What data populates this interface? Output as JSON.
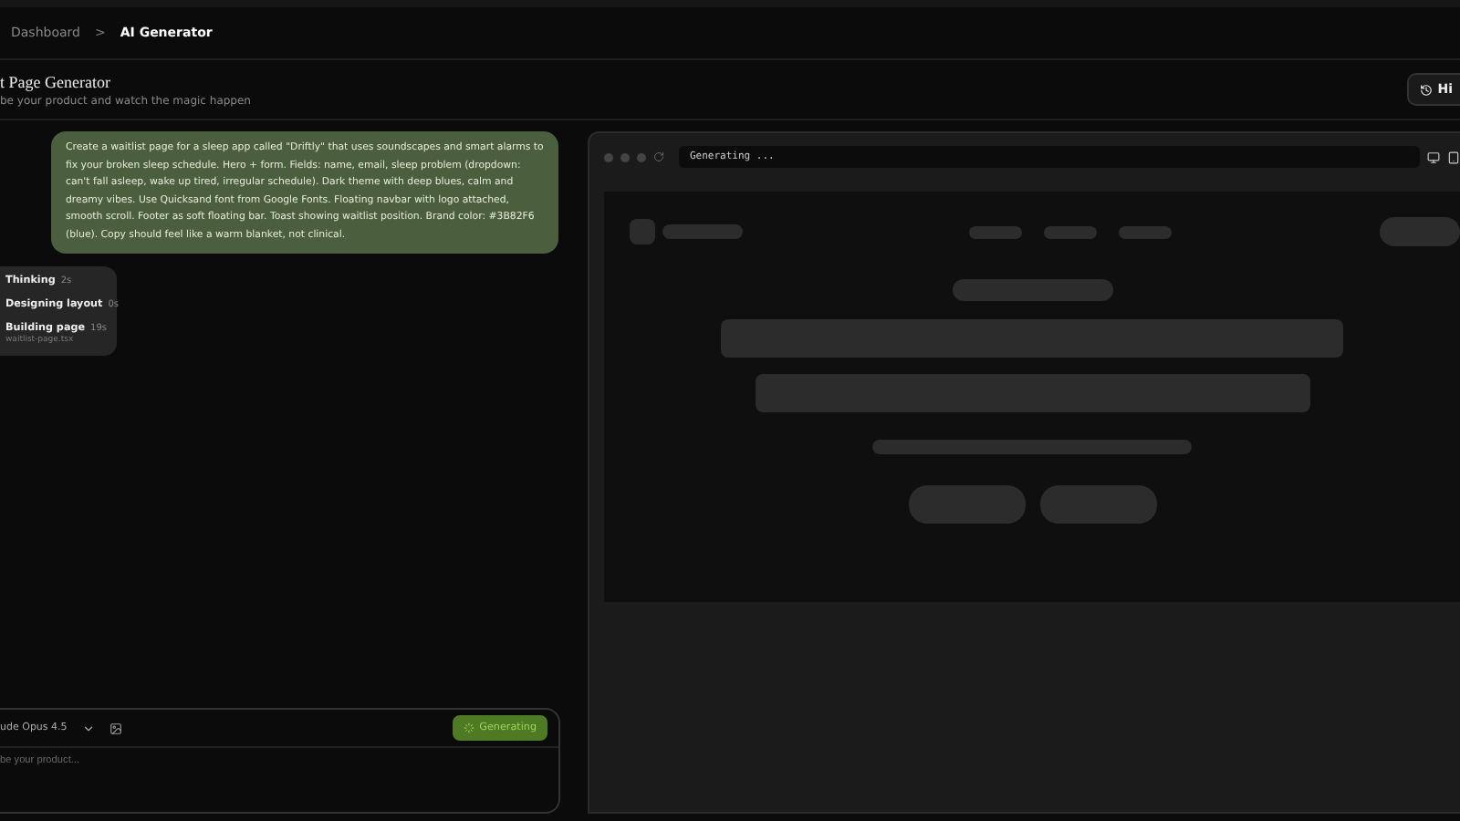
{
  "breadcrumb": [
    {
      "label": "Dashboard",
      "selected": false
    },
    {
      "label": "AI Generator",
      "selected": true
    }
  ],
  "breadcrumb_separator": ">",
  "header": {
    "title": "t Page Generator",
    "subtitle": "be your product and watch the magic happen",
    "history_button": "Hi"
  },
  "chat": {
    "message": "Create a waitlist page for a sleep app called \"Driftly\" that uses soundscapes and smart alarms to fix your broken sleep schedule. Hero + form. Fields: name, email, sleep problem (dropdown: can't fall asleep, wake up tired, irregular schedule). Dark theme with deep blues, calm and dreamy vibes. Use Quicksand font from Google Fonts. Floating navbar with logo attached, smooth scroll. Footer as soft floating bar. Toast showing waitlist position. Brand color: #3B82F6 (blue). Copy should feel like a warm blanket, not clinical.",
    "steps": [
      {
        "label": "Thinking",
        "time": "2s"
      },
      {
        "label": "Designing layout",
        "time": "0s"
      },
      {
        "label": "Building page",
        "time": "19s",
        "detail": "waitlist-page.tsx"
      }
    ]
  },
  "composer": {
    "model": "ude Opus 4.5",
    "generate_button": "Generating",
    "generating": true,
    "placeholder": "be your product..."
  },
  "preview": {
    "address": "Generating ..."
  }
}
